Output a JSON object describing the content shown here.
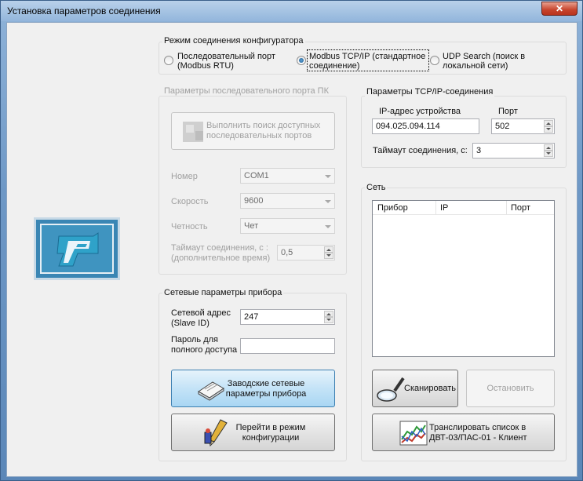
{
  "window": {
    "title": "Установка параметров соединения",
    "close_glyph": "✕"
  },
  "mode": {
    "label": "Режим соединения конфигуратора",
    "options": [
      {
        "line1": "Последовательный порт",
        "line2": "(Modbus RTU)",
        "selected": false
      },
      {
        "line1": "Modbus TCP/IP (стандартное",
        "line2": "соединение)",
        "selected": true
      },
      {
        "line1": "UDP Search (поиск в",
        "line2": "локальной сети)",
        "selected": false
      }
    ]
  },
  "serial": {
    "label": "Параметры последовательного порта ПК",
    "search_button": {
      "line1": "Выполнить поиск доступных",
      "line2": "последовательных портов",
      "icon": "port-search-icon"
    },
    "number_label": "Номер",
    "number_value": "COM1",
    "speed_label": "Скорость",
    "speed_value": "9600",
    "parity_label": "Четность",
    "parity_value": "Чет",
    "timeout_label1": "Таймаут соединения, с :",
    "timeout_label2": "(дополнительное время)",
    "timeout_value": "0,5"
  },
  "tcp": {
    "label": "Параметры TCP/IP-соединения",
    "ip_label": "IP-адрес устройства",
    "ip_value": "094.025.094.114",
    "port_label": "Порт",
    "port_value": "502",
    "timeout_label": "Таймаут соединения, с:",
    "timeout_value": "3"
  },
  "device": {
    "label": "Сетевые параметры прибора",
    "addr_label1": "Сетевой адрес",
    "addr_label2": "(Slave ID)",
    "addr_value": "247",
    "pwd_label1": "Пароль для",
    "pwd_label2": "полного доступа",
    "pwd_value": "",
    "factory_button": {
      "line1": "Заводские сетевые",
      "line2": "параметры прибора",
      "icon": "document-stack-icon"
    },
    "config_button": {
      "line1": "Перейти в режим",
      "line2": "конфигурации",
      "icon": "pen-config-icon"
    }
  },
  "network": {
    "label": "Сеть",
    "columns": [
      "Прибор",
      "IP",
      "Порт"
    ],
    "rows": [],
    "scan_button": {
      "label": "Сканировать",
      "icon": "magnifier-icon"
    },
    "stop_button": {
      "label": "Остановить"
    },
    "transmit_button": {
      "line1": "Транслировать список в",
      "line2": "ДВТ-03/ПАС-01 - Клиент",
      "icon": "chart-icon"
    }
  },
  "colors": {
    "accent": "#3c7fb1",
    "logo_bg": "#3a86b4"
  }
}
